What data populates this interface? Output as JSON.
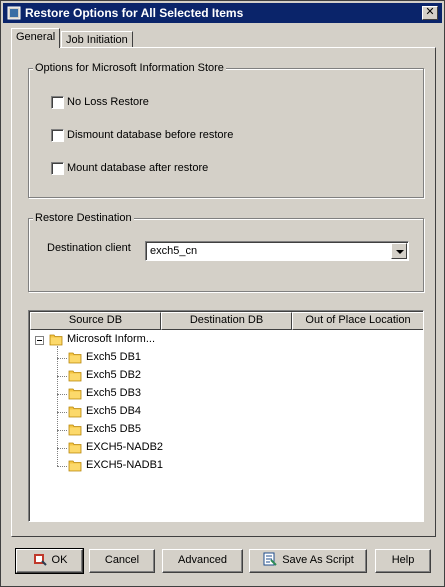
{
  "window": {
    "title": "Restore Options for All Selected Items",
    "close_label": "✕"
  },
  "tabs": [
    {
      "label": "General",
      "active": true
    },
    {
      "label": "Job Initiation",
      "active": false
    }
  ],
  "info_store_group": {
    "legend": "Options for Microsoft Information Store",
    "options": [
      {
        "label": "No Loss Restore",
        "checked": false
      },
      {
        "label": "Dismount database before restore",
        "checked": false
      },
      {
        "label": "Mount database after restore",
        "checked": false
      }
    ]
  },
  "restore_destination": {
    "legend": "Restore Destination",
    "client_label": "Destination client",
    "client_value": "exch5_cn"
  },
  "tree_table": {
    "columns": [
      "Source DB",
      "Destination DB",
      "Out of Place Location"
    ],
    "root": {
      "label": "Microsoft Inform...",
      "expanded": true
    },
    "children": [
      "Exch5 DB1",
      "Exch5 DB2",
      "Exch5 DB3",
      "Exch5 DB4",
      "Exch5 DB5",
      "EXCH5-NADB2",
      "EXCH5-NADB1"
    ]
  },
  "buttons": {
    "ok": "OK",
    "cancel": "Cancel",
    "advanced": "Advanced",
    "save_script": "Save As Script",
    "help": "Help"
  },
  "colors": {
    "titlebar": "#0a246a",
    "dialog_face": "#d4d0c8",
    "folder": "#f5c542"
  }
}
